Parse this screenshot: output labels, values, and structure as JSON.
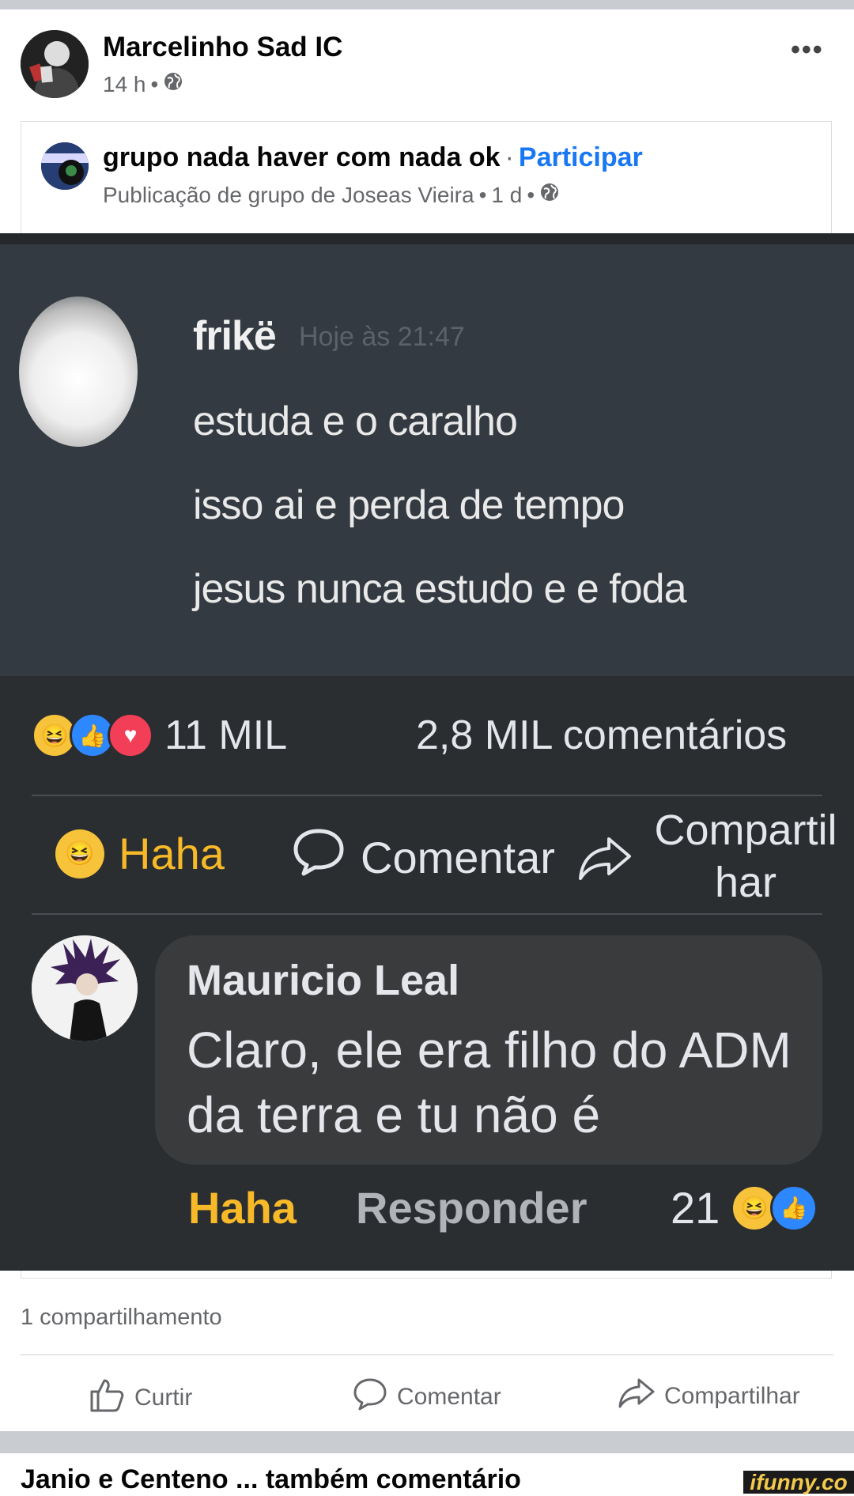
{
  "post": {
    "author": "Marcelinho Sad IC",
    "time": "14 h",
    "separator": "•",
    "more": "•••"
  },
  "shared_post": {
    "group_name": "grupo nada haver com nada ok",
    "dot": "·",
    "join_label": "Participar",
    "subtitle": "Publicação de grupo de Joseas Vieira",
    "sub_time": "1 d",
    "separator": "•"
  },
  "meme": {
    "discord": {
      "username": "frikë",
      "timestamp": "Hoje às 21:47",
      "lines": [
        "estuda e o caralho",
        "isso ai e perda de tempo",
        "jesus nunca estudo e e foda"
      ]
    },
    "reactions_count": "11 MIL",
    "comments_count": "2,8 MIL comentários",
    "actions": {
      "haha": "Haha",
      "comment": "Comentar",
      "share_line1": "Compartil",
      "share_line2": "har"
    },
    "comment": {
      "author": "Mauricio Leal",
      "text": "Claro, ele era filho do ADM da terra e tu não é",
      "haha": "Haha",
      "reply": "Responder",
      "count": "21"
    }
  },
  "footer": {
    "share_count": "1 compartilhamento",
    "like": "Curtir",
    "comment": "Comentar",
    "share": "Compartilhar"
  },
  "next_post_preview": "Janio e Centeno ... também comentário",
  "watermark": "ifunny.co",
  "colors": {
    "accent": "#1877f2",
    "haha": "#f7b928",
    "meme_bg": "#2b2e31",
    "bubble": "#3a3b3c"
  }
}
